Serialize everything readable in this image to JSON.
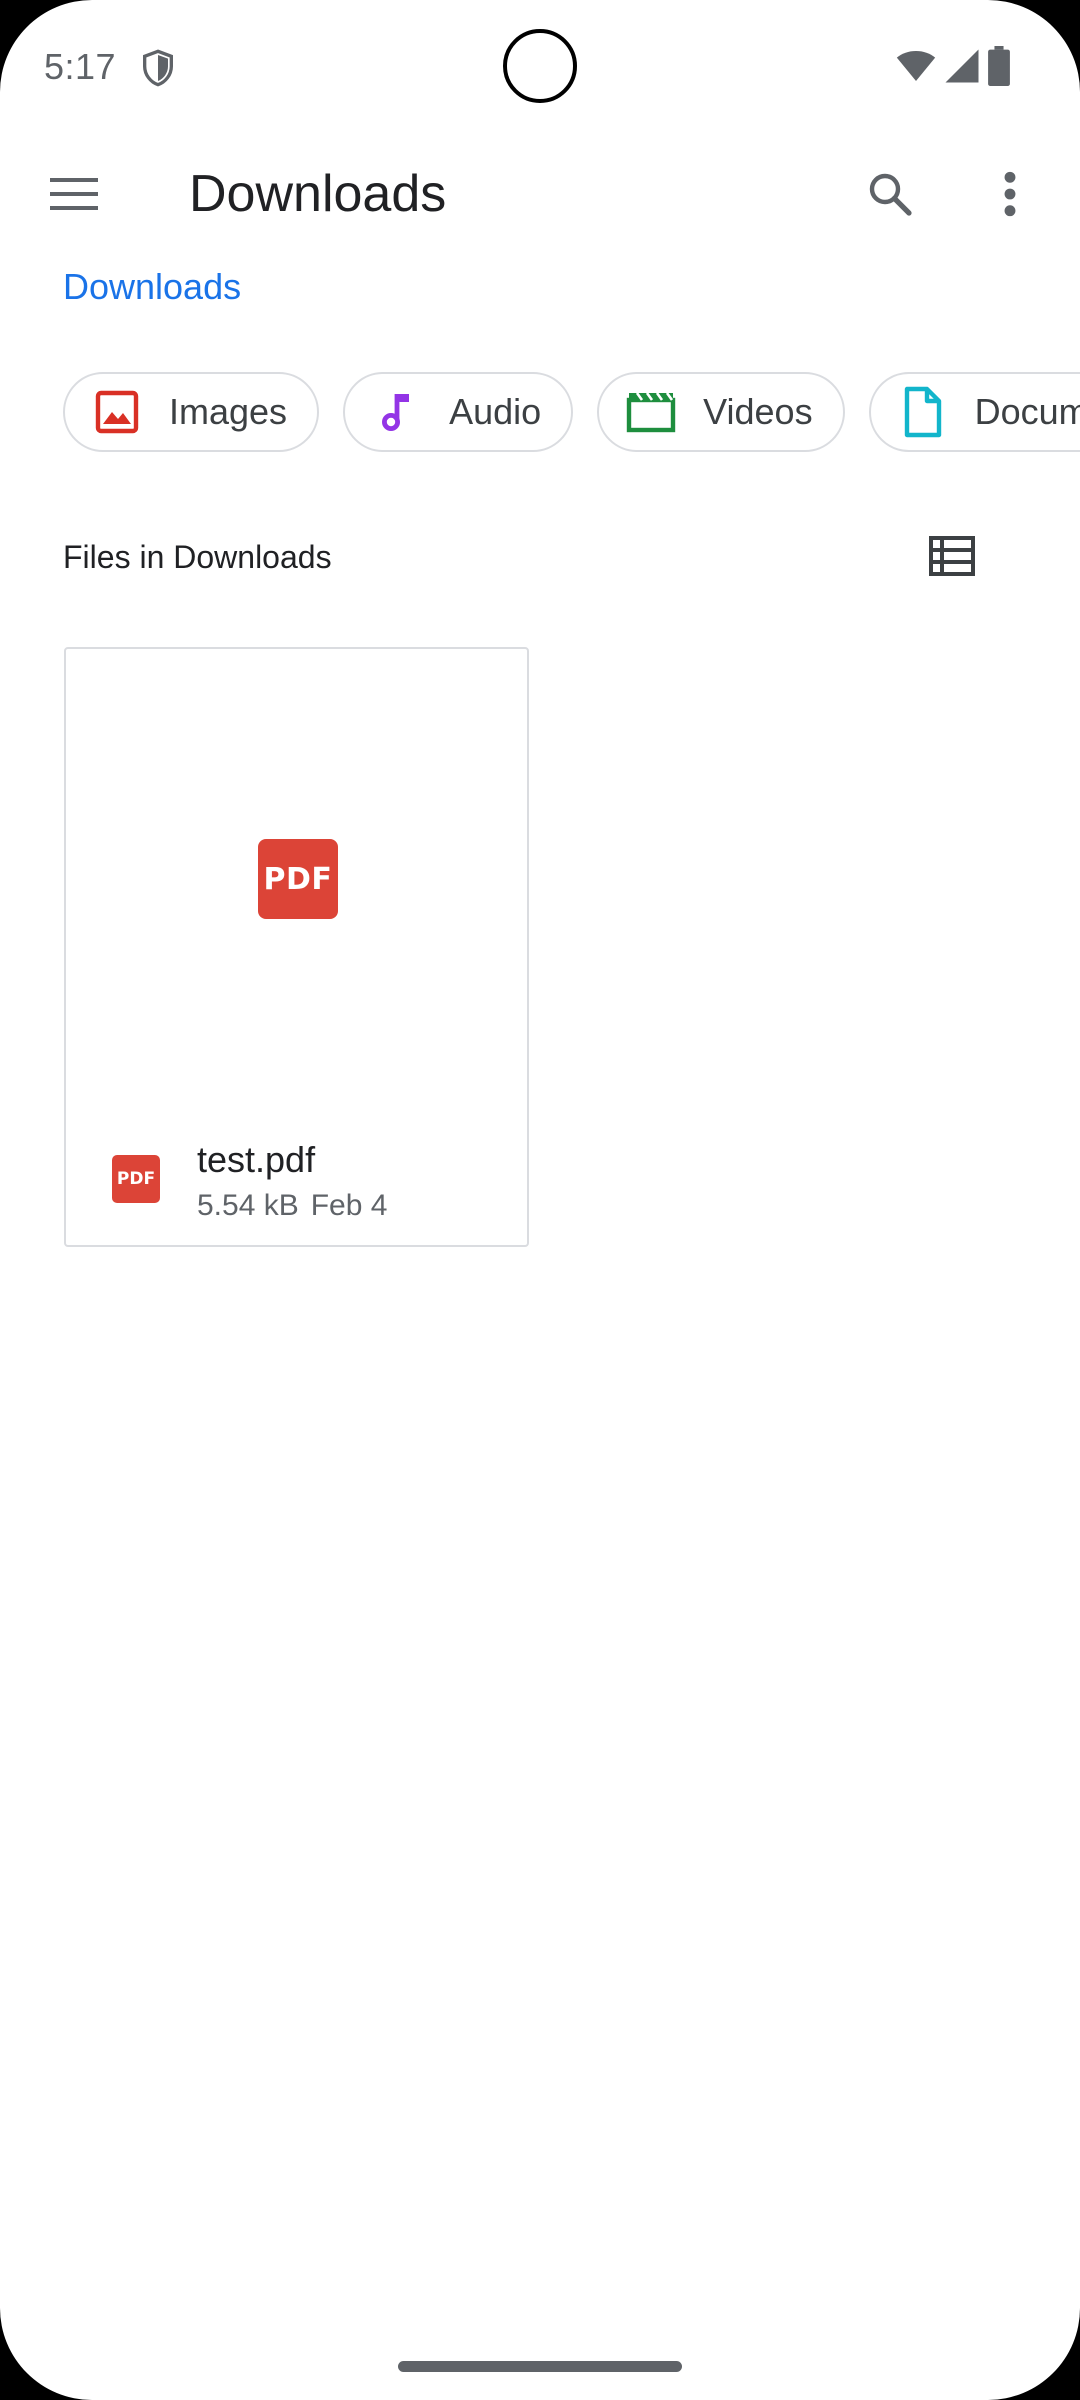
{
  "status_bar": {
    "time": "5:17",
    "icons": [
      "shield-icon",
      "wifi-icon",
      "signal-icon",
      "battery-icon"
    ]
  },
  "app_bar": {
    "title": "Downloads",
    "icons": [
      "menu-icon",
      "search-icon",
      "more-vert-icon"
    ]
  },
  "breadcrumb": {
    "label": "Downloads",
    "color": "#1a73e8"
  },
  "chips": [
    {
      "label": "Images",
      "icon": "image-icon",
      "color": "#d93025"
    },
    {
      "label": "Audio",
      "icon": "music-note-icon",
      "color": "#9334e6"
    },
    {
      "label": "Videos",
      "icon": "movie-icon",
      "color": "#1e8e3e"
    },
    {
      "label": "Documents",
      "icon": "document-icon",
      "color": "#12b5cb"
    }
  ],
  "section": {
    "title": "Files in Downloads",
    "view_toggle_icon": "list-view-icon"
  },
  "files": [
    {
      "thumbnail_label": "PDF",
      "type_label": "PDF",
      "name": "test.pdf",
      "size": "5.54 kB",
      "date": "Feb 4",
      "color": "#dc4437"
    }
  ]
}
